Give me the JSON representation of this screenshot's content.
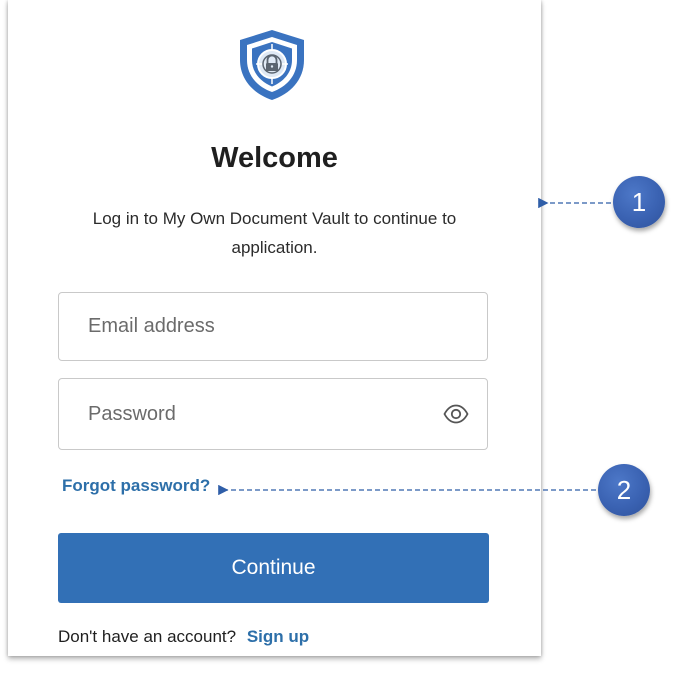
{
  "brand": {
    "logo_icon": "shield-lock-icon",
    "colors": {
      "shield_blue": "#3a73c0",
      "accent_link": "#2d6fa9",
      "button_bg": "#3270b6"
    }
  },
  "login": {
    "title": "Welcome",
    "subtitle": "Log in to My Own Document Vault to continue to application.",
    "email": {
      "placeholder": "Email address",
      "value": ""
    },
    "password": {
      "placeholder": "Password",
      "value": "",
      "toggle_icon": "eye-icon"
    },
    "forgot_label": "Forgot password?",
    "continue_label": "Continue",
    "signup_prompt": "Don't have an account?",
    "signup_label": "Sign up"
  },
  "callouts": [
    {
      "label": "1"
    },
    {
      "label": "2"
    }
  ]
}
